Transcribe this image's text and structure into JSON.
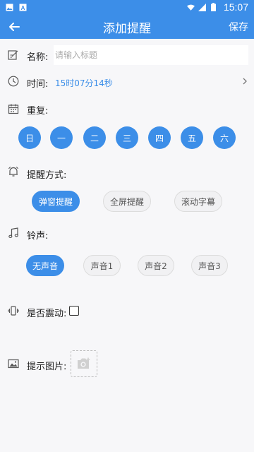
{
  "status_bar": {
    "time": "15:07",
    "icons": [
      "image-icon",
      "text-a-icon",
      "wifi-icon",
      "signal-icon",
      "battery-icon"
    ]
  },
  "app_bar": {
    "title": "添加提醒",
    "save_label": "保存",
    "color": "#3c8ee8"
  },
  "form": {
    "name": {
      "label": "名称:",
      "placeholder": "请输入标题",
      "value": ""
    },
    "time": {
      "label": "时间:",
      "value": "15时07分14秒"
    },
    "repeat": {
      "label": "重复:",
      "days": [
        "日",
        "一",
        "二",
        "三",
        "四",
        "五",
        "六"
      ]
    },
    "reminder_mode": {
      "label": "提醒方式:",
      "options": [
        "弹窗提醒",
        "全屏提醒",
        "滚动字幕"
      ],
      "selected": "弹窗提醒"
    },
    "ringtone": {
      "label": "铃声:",
      "options": [
        "无声音",
        "声音1",
        "声音2",
        "声音3"
      ],
      "selected": "无声音"
    },
    "vibrate": {
      "label": "是否震动:",
      "checked": false
    },
    "image": {
      "label": "提示图片:"
    }
  }
}
